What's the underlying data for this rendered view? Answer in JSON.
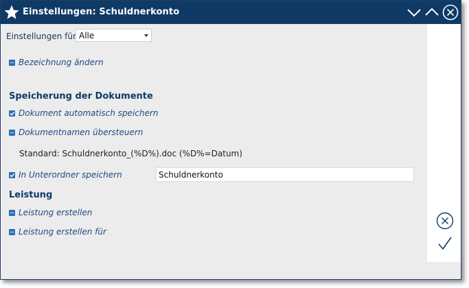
{
  "window": {
    "title": "Einstellungen: Schuldnerkonto",
    "icons": {
      "app": "star-icon",
      "minimize": "chevron-down-icon",
      "maximize": "chevron-up-icon",
      "close": "close-circle-icon"
    }
  },
  "filter": {
    "label": "Einstellungen für",
    "selected": "Alle"
  },
  "sections": {
    "rename": {
      "label": "Bezeichnung ändern",
      "state": "collapsed"
    },
    "documents": {
      "heading": "Speicherung der Dokumente",
      "auto_save": {
        "label": "Dokument automatisch speichern",
        "checked": true
      },
      "override_names": {
        "label": "Dokumentnamen übersteuern",
        "state": "collapsed"
      },
      "standard_text": "Standard: Schuldnerkonto_(%D%).doc (%D%=Datum)",
      "subfolder": {
        "label": "In Unterordner speichern",
        "checked": true,
        "value": "Schuldnerkonto"
      }
    },
    "service": {
      "heading": "Leistung",
      "create": {
        "label": "Leistung erstellen",
        "state": "collapsed"
      },
      "create_for": {
        "label": "Leistung erstellen für",
        "state": "collapsed"
      }
    }
  },
  "actions": {
    "cancel": "cancel-circle-icon",
    "confirm": "checkmark-icon"
  },
  "colors": {
    "titlebar": "#0f3a66",
    "accent": "#2f6fb3",
    "background": "#ececec"
  }
}
